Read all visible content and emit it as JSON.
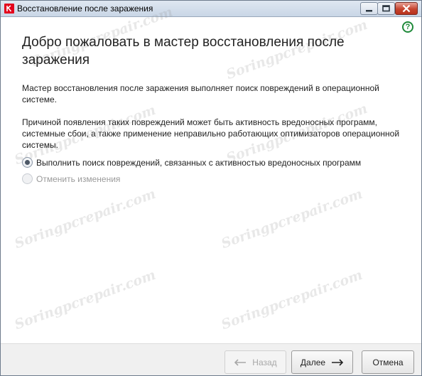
{
  "window": {
    "title": "Восстановление после заражения",
    "controls": {
      "minimize": "minimize-icon",
      "maximize": "maximize-icon",
      "close": "close-icon"
    }
  },
  "help_icon": "?",
  "heading": "Добро пожаловать в мастер восстановления после заражения",
  "paragraphs": [
    "Мастер восстановления после заражения выполняет поиск повреждений в операционной системе.",
    "Причиной появления таких повреждений может быть активность вредоносных программ, системные сбои, а также применение неправильно работающих оптимизаторов операционной системы."
  ],
  "options": [
    {
      "label": "Выполнить поиск повреждений, связанных с активностью вредоносных программ",
      "selected": true,
      "enabled": true
    },
    {
      "label": "Отменить изменения",
      "selected": false,
      "enabled": false
    }
  ],
  "watermark": "Soringpcrepair.com",
  "footer": {
    "back_label": "Назад",
    "next_label": "Далее",
    "cancel_label": "Отмена"
  },
  "colors": {
    "accent_green": "#1f8a3a",
    "brand_red": "#e3001b",
    "close_button": "#c6442f"
  }
}
